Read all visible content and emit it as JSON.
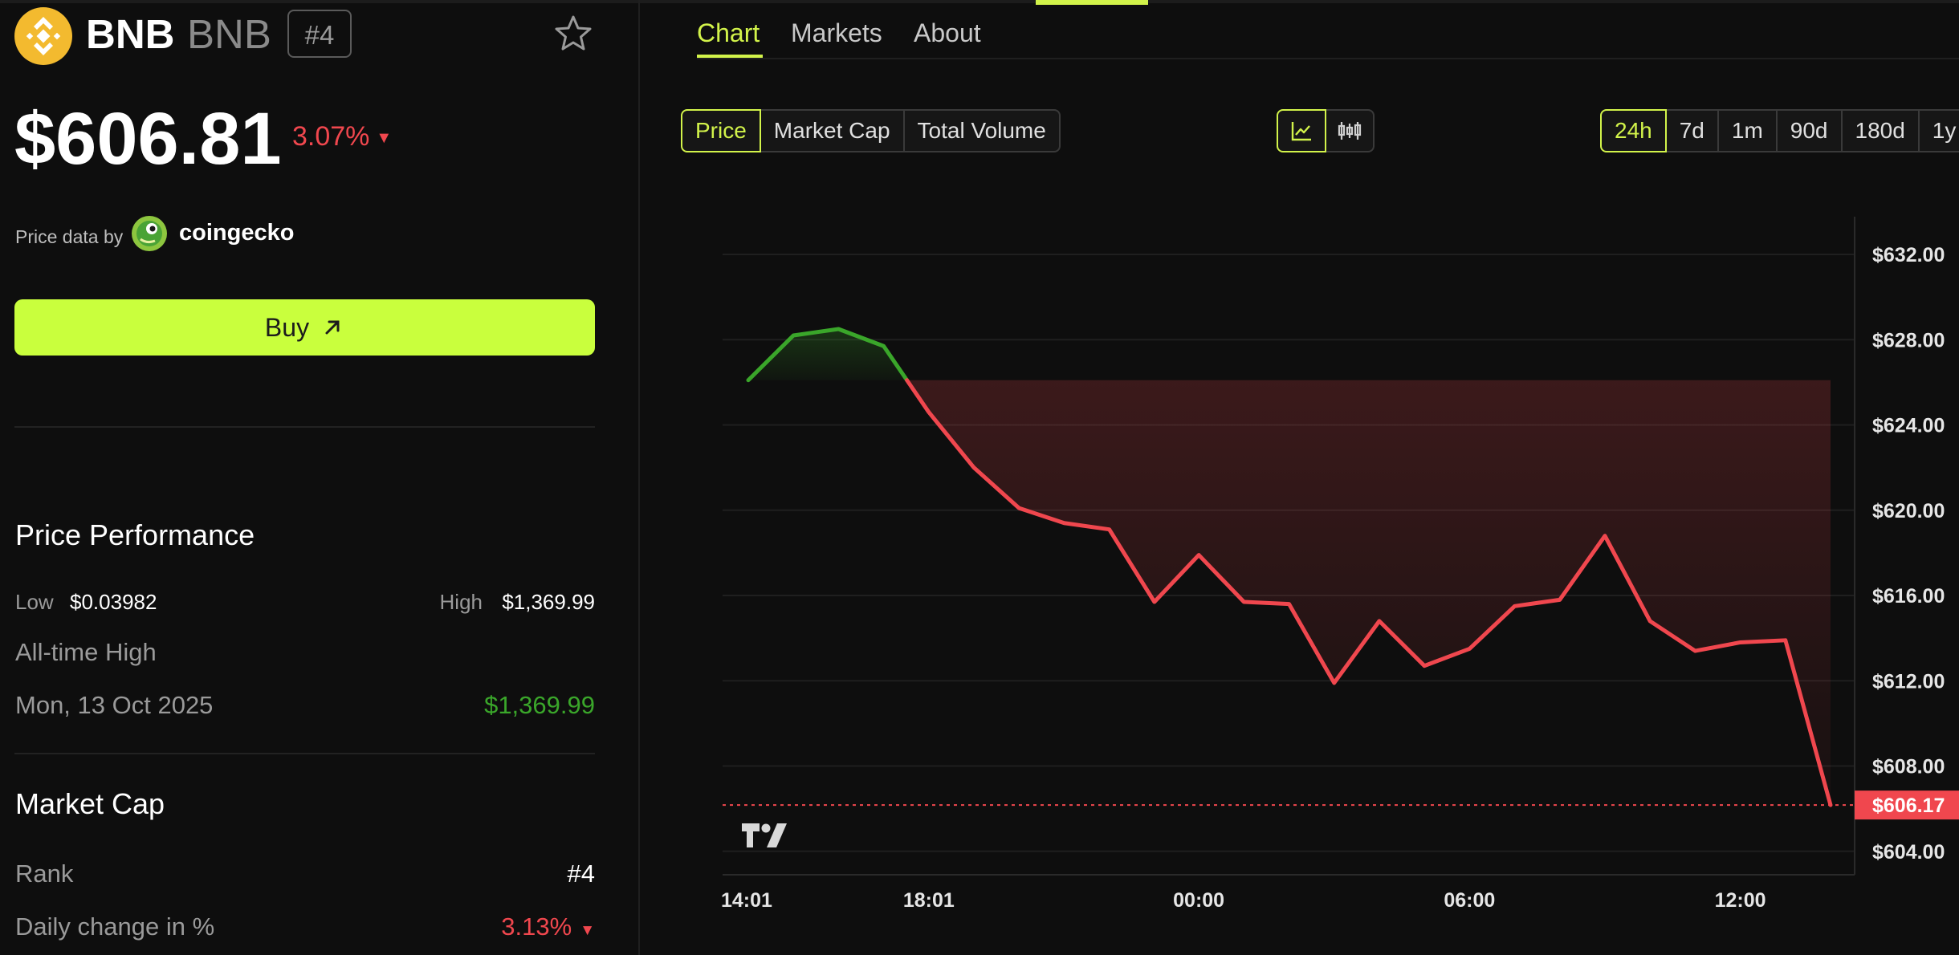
{
  "coin": {
    "name": "BNB",
    "symbol": "BNB",
    "rank": "#4",
    "price": "$606.81",
    "change_pct": "3.07%",
    "change_direction": "down"
  },
  "price_source": {
    "label": "Price data by",
    "provider": "coingecko"
  },
  "buy_button": {
    "label": "Buy"
  },
  "price_performance": {
    "title": "Price Performance",
    "low_label": "Low",
    "low_value": "$0.03982",
    "high_label": "High",
    "high_value": "$1,369.99",
    "ath_label": "All-time High",
    "ath_date": "Mon, 13 Oct 2025",
    "ath_value": "$1,369.99"
  },
  "market_cap": {
    "title": "Market Cap",
    "rank_label": "Rank",
    "rank_value": "#4",
    "daily_change_label": "Daily change in %",
    "daily_change_value": "3.13%"
  },
  "tabs": [
    {
      "label": "Chart",
      "active": true
    },
    {
      "label": "Markets",
      "active": false
    },
    {
      "label": "About",
      "active": false
    }
  ],
  "metric_buttons": [
    {
      "label": "Price",
      "active": true
    },
    {
      "label": "Market Cap",
      "active": false
    },
    {
      "label": "Total Volume",
      "active": false
    }
  ],
  "chart_type_buttons": [
    {
      "icon": "line-chart-icon",
      "active": true
    },
    {
      "icon": "candlestick-icon",
      "active": false
    }
  ],
  "range_buttons": [
    {
      "label": "24h",
      "active": true
    },
    {
      "label": "7d",
      "active": false
    },
    {
      "label": "1m",
      "active": false
    },
    {
      "label": "90d",
      "active": false
    },
    {
      "label": "180d",
      "active": false
    },
    {
      "label": "1y",
      "active": false
    }
  ],
  "colors": {
    "accent": "#d2f34a",
    "buy": "#c9ff3d",
    "up": "#3aa62a",
    "down": "#f0474e",
    "background": "#0e0e0e"
  },
  "chart_data": {
    "type": "line",
    "x_ticks": [
      "14:01",
      "18:01",
      "00:00",
      "06:00",
      "12:00"
    ],
    "y_ticks": [
      "$632.00",
      "$628.00",
      "$624.00",
      "$620.00",
      "$616.00",
      "$612.00",
      "$608.00",
      "$604.00"
    ],
    "ylim": [
      602.9,
      634.9
    ],
    "baseline": 626.1,
    "current_label": "$606.17",
    "current_value": 606.17,
    "series": [
      {
        "times": [
          "14:01",
          "15:01",
          "16:01",
          "17:01",
          "18:01",
          "19:01",
          "20:01",
          "21:01",
          "22:01",
          "23:01",
          "00:00",
          "01:00",
          "02:00",
          "03:00",
          "04:00",
          "05:00",
          "06:00",
          "07:00",
          "08:00",
          "09:00",
          "10:00",
          "11:00",
          "12:00",
          "13:00",
          "14:00"
        ],
        "values": [
          626.1,
          628.2,
          628.5,
          627.7,
          624.6,
          622.0,
          620.1,
          619.4,
          619.1,
          615.7,
          617.9,
          615.7,
          615.6,
          611.9,
          614.8,
          612.7,
          613.5,
          615.5,
          615.8,
          618.8,
          614.8,
          613.4,
          613.8,
          613.9,
          606.17
        ]
      }
    ]
  }
}
